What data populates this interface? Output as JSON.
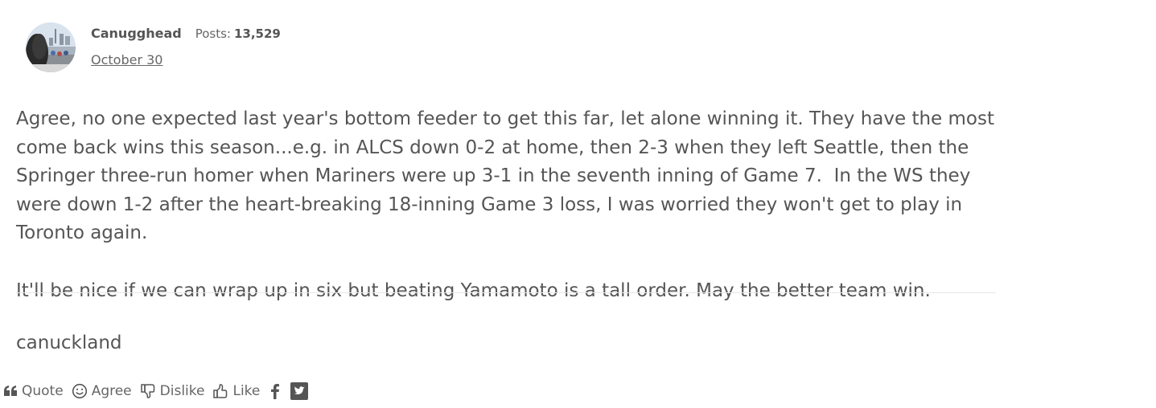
{
  "post": {
    "author": "Canugghead",
    "posts_label": "Posts:",
    "posts_count": "13,529",
    "date": "October 30",
    "paragraphs": [
      "Agree, no one expected last year's bottom feeder to get this far, let alone winning it. They have the most come back wins this season...e.g. in ALCS down 0-2 at home, then 2-3 when they left Seattle, then the Springer three-run homer when Mariners were up 3-1 in the seventh inning of Game 7.  In the WS they were down 1-2 after the heart-breaking 18-inning Game 3 loss, I was worried they won't get to play in Toronto again.",
      "It'll be nice if we can wrap up in six but beating Yamamoto is a tall order. May the better team win."
    ],
    "signature": "canuckland"
  },
  "reactions": {
    "quote": "Quote",
    "agree": "Agree",
    "dislike": "Dislike",
    "like": "Like"
  },
  "icons": {
    "quote": "quote-icon",
    "agree": "smile-icon",
    "dislike": "thumbs-down-icon",
    "like": "thumbs-up-icon",
    "facebook": "facebook-icon",
    "twitter": "twitter-icon"
  },
  "colors": {
    "text": "#555555",
    "muted": "#666666",
    "divider": "#e6e6e6"
  }
}
